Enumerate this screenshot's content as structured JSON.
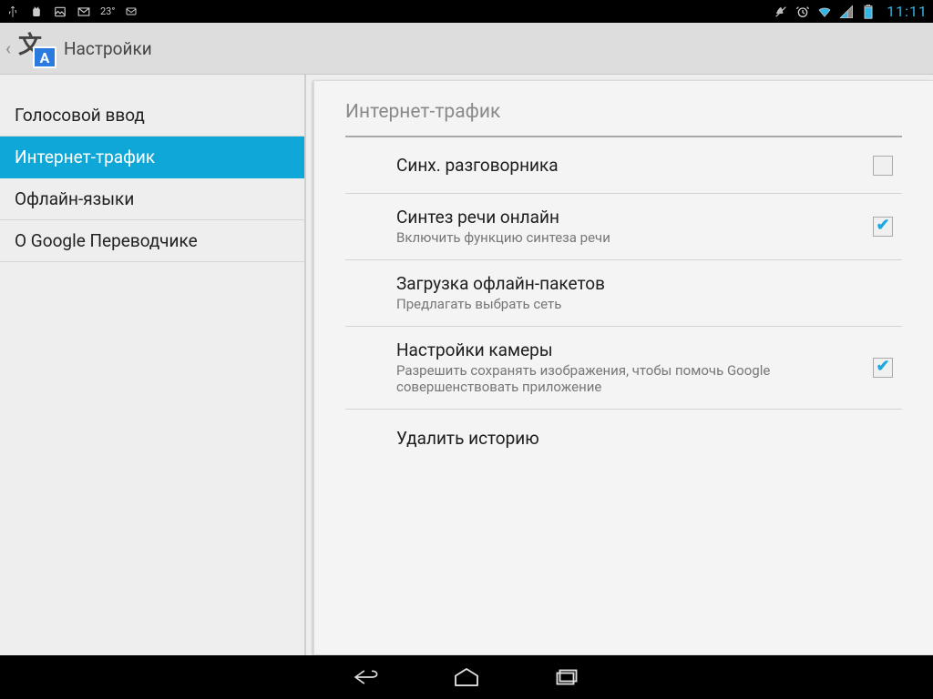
{
  "status": {
    "temp": "23°",
    "clock": "11:11"
  },
  "actionbar": {
    "title": "Настройки"
  },
  "sidebar": {
    "items": [
      {
        "label": "Голосовой ввод",
        "selected": false
      },
      {
        "label": "Интернет-трафик",
        "selected": true
      },
      {
        "label": "Офлайн-языки",
        "selected": false
      },
      {
        "label": "О Google Переводчике",
        "selected": false
      }
    ]
  },
  "panel": {
    "section": "Интернет-трафик",
    "rows": [
      {
        "title": "Синх. разговорника",
        "sub": "",
        "check": "off"
      },
      {
        "title": "Синтез речи онлайн",
        "sub": "Включить функцию синтеза речи",
        "check": "on"
      },
      {
        "title": "Загрузка офлайн-пакетов",
        "sub": "Предлагать выбрать сеть",
        "check": "none"
      },
      {
        "title": "Настройки камеры",
        "sub": "Разрешить сохранять изображения, чтобы помочь Google совершенствовать приложение",
        "check": "on"
      },
      {
        "title": "Удалить историю",
        "sub": "",
        "check": "none"
      }
    ]
  }
}
